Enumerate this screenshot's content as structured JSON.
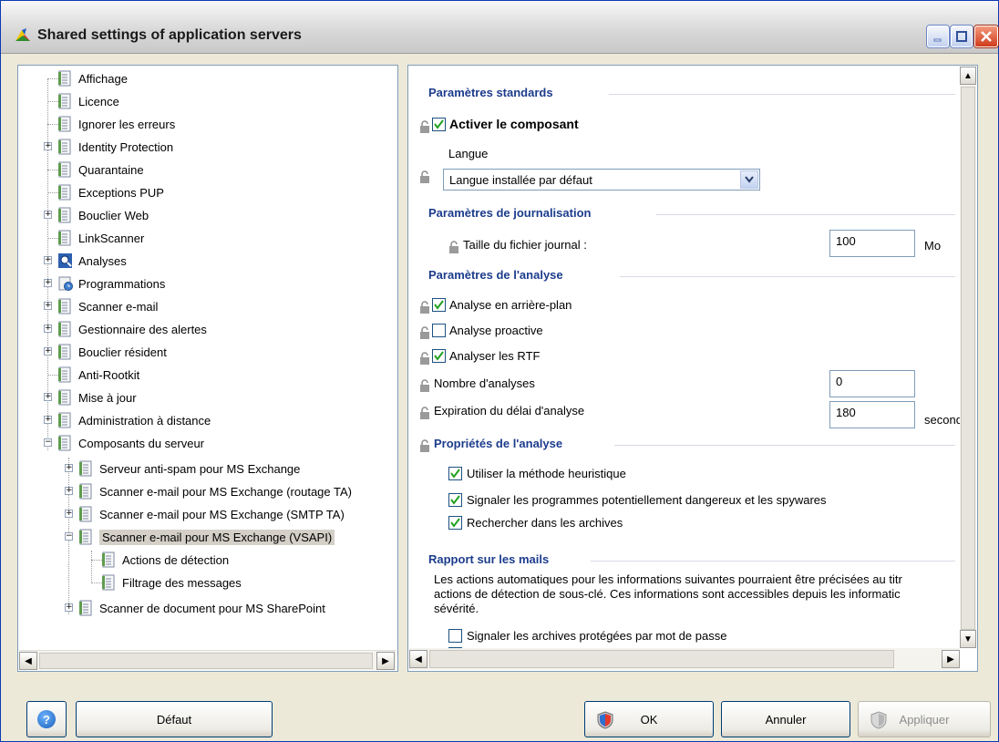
{
  "window": {
    "title": "Shared settings of application servers"
  },
  "tree": {
    "items": [
      {
        "label": "Affichage"
      },
      {
        "label": "Licence"
      },
      {
        "label": "Ignorer les erreurs"
      },
      {
        "label": "Identity Protection"
      },
      {
        "label": "Quarantaine"
      },
      {
        "label": "Exceptions PUP"
      },
      {
        "label": "Bouclier Web"
      },
      {
        "label": "LinkScanner"
      },
      {
        "label": "Analyses"
      },
      {
        "label": "Programmations"
      },
      {
        "label": "Scanner e-mail"
      },
      {
        "label": "Gestionnaire des alertes"
      },
      {
        "label": "Bouclier résident"
      },
      {
        "label": "Anti-Rootkit"
      },
      {
        "label": "Mise à jour"
      },
      {
        "label": "Administration à distance"
      },
      {
        "label": "Composants du serveur"
      },
      {
        "label": "Serveur anti-spam pour MS Exchange"
      },
      {
        "label": "Scanner e-mail pour MS Exchange (routage TA)"
      },
      {
        "label": "Scanner e-mail pour MS Exchange (SMTP TA)"
      },
      {
        "label": "Scanner e-mail pour MS Exchange (VSAPI)"
      },
      {
        "label": "Actions de détection"
      },
      {
        "label": "Filtrage des messages"
      },
      {
        "label": "Scanner de document pour MS SharePoint"
      }
    ]
  },
  "settings": {
    "standard": {
      "title": "Paramètres standards",
      "enable_label": "Activer le composant",
      "enable_checked": true,
      "language_label": "Langue",
      "language_value": "Langue installée par défaut"
    },
    "logging": {
      "title": "Paramètres de journalisation",
      "log_size_label": "Taille du fichier journal :",
      "log_size_value": "100",
      "log_size_unit": "Mo"
    },
    "scan": {
      "title": "Paramètres de l'analyse",
      "background_label": "Analyse en arrière-plan",
      "background_checked": true,
      "proactive_label": "Analyse proactive",
      "proactive_checked": false,
      "rtf_label": "Analyser les RTF",
      "rtf_checked": true,
      "count_label": "Nombre d'analyses",
      "count_value": "0",
      "timeout_label": "Expiration du délai d'analyse",
      "timeout_value": "180",
      "timeout_unit": "seconde"
    },
    "properties": {
      "title": "Propriétés de l'analyse",
      "heuristic_label": "Utiliser la méthode heuristique",
      "pup_label": "Signaler les programmes potentiellement dangereux et les spywares",
      "archives_label": "Rechercher dans les archives"
    },
    "report": {
      "title": "Rapport sur les mails",
      "desc_line1": "Les actions automatiques pour les informations suivantes pourraient être précisées au titr",
      "desc_line2": "actions de détection de sous-clé. Ces informations sont accessibles depuis les informatic",
      "desc_line3": "sévérité.",
      "protected_archives_label": "Signaler les archives protégées par mot de passe"
    }
  },
  "buttons": {
    "default": "Défaut",
    "ok": "OK",
    "cancel": "Annuler",
    "apply": "Appliquer"
  }
}
